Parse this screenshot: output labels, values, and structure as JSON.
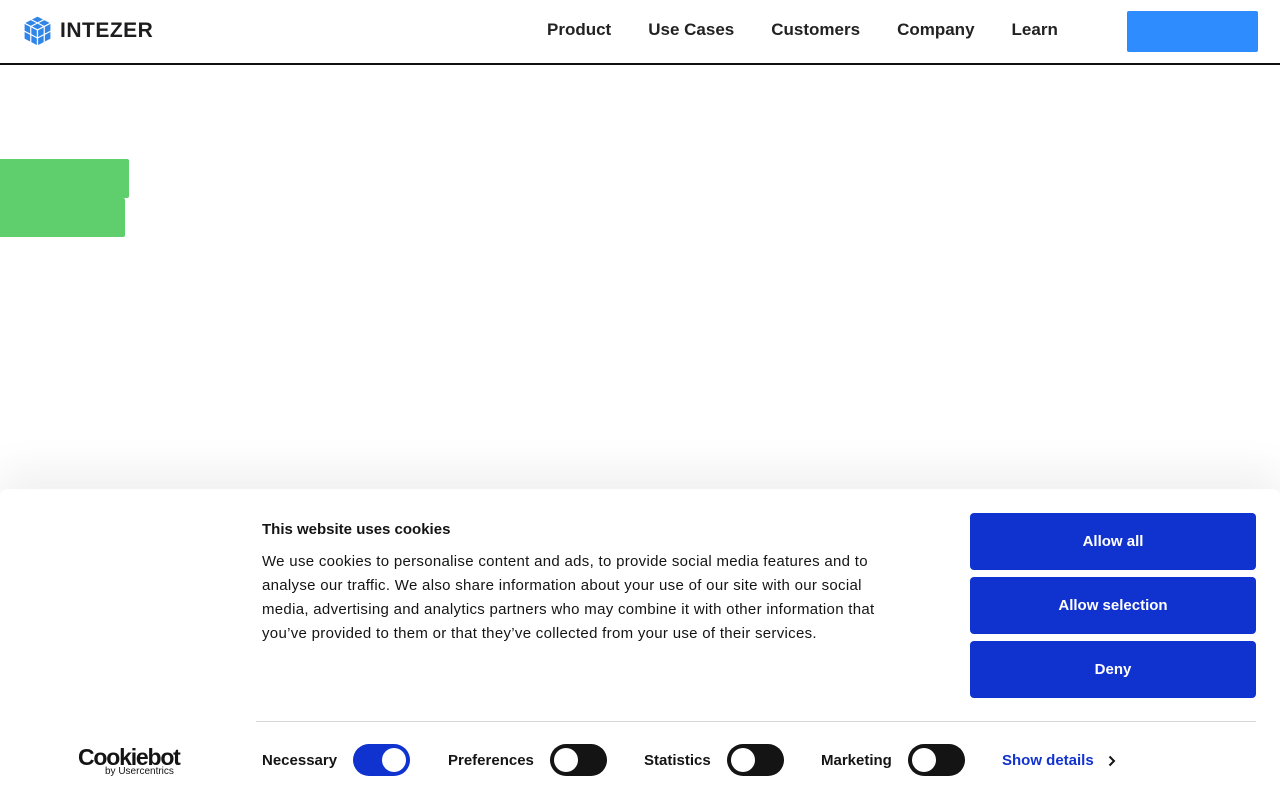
{
  "header": {
    "brand": "INTEZER",
    "nav": [
      "Product",
      "Use Cases",
      "Customers",
      "Company",
      "Learn"
    ],
    "cta_label": "",
    "colors": {
      "cta": "#2f8cff",
      "green_block": "#5fce6d"
    }
  },
  "cookie_banner": {
    "title": "This website uses cookies",
    "body": "We use cookies to personalise content and ads, to provide social media features and to analyse our traffic. We also share information about your use of our site with our social media, advertising and analytics partners who may combine it with other information that you’ve provided to them or that they’ve collected from your use of their services.",
    "buttons": {
      "allow_all": "Allow all",
      "allow_selection": "Allow selection",
      "deny": "Deny"
    },
    "toggles": [
      {
        "label": "Necessary",
        "on": true
      },
      {
        "label": "Preferences",
        "on": false
      },
      {
        "label": "Statistics",
        "on": false
      },
      {
        "label": "Marketing",
        "on": false
      }
    ],
    "show_details": "Show details",
    "branding": {
      "name": "Cookiebot",
      "by": "by Usercentrics"
    },
    "colors": {
      "primary": "#1032cf",
      "toggle_off": "#141414"
    }
  }
}
